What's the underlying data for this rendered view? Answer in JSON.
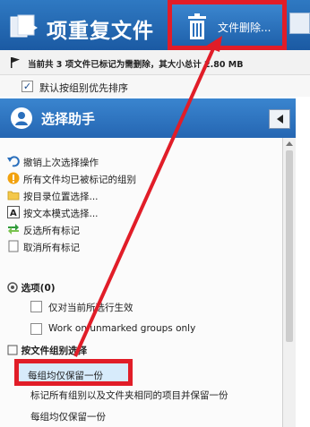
{
  "header": {
    "title": "项重复文件",
    "delete_button_label": "文件删除..."
  },
  "infobar": {
    "text": "当前共 3 项文件已标记为需删除，其大小总计 2.80 MB"
  },
  "sort_option": {
    "label": "默认按组别优先排序",
    "checked": true
  },
  "assistant": {
    "title": "选择助手",
    "actions": [
      {
        "label": "撤销上次选择操作",
        "icon": "undo-icon"
      },
      {
        "label": "所有文件均已被标记的组别",
        "icon": "warning-icon"
      },
      {
        "label": "按目录位置选择...",
        "icon": "folder-icon"
      },
      {
        "label": "按文本模式选择...",
        "icon": "text-a-icon"
      },
      {
        "label": "反选所有标记",
        "icon": "invert-arrows-icon"
      },
      {
        "label": "取消所有标记",
        "icon": "page-icon"
      }
    ],
    "options_title": "选项(0)",
    "options": [
      {
        "label": "仅对当前所选行生效",
        "checked": false
      },
      {
        "label": "Work on unmarked groups only",
        "checked": false
      }
    ],
    "group_section_title": "按文件组别选择",
    "group_actions": [
      "每组均仅保留一份",
      "标记所有组别以及文件夹相同的项目并保留一份",
      "每组均仅保留一份"
    ]
  },
  "colors": {
    "header_blue": "#2567b3",
    "annotation_red": "#e11d28",
    "highlight_bg": "#d7ebfb"
  }
}
